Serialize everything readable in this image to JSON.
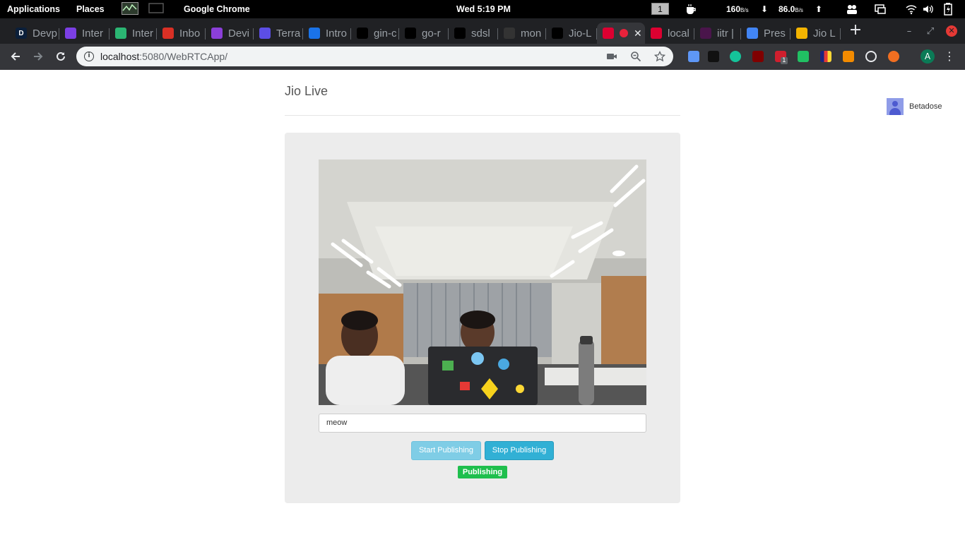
{
  "topbar": {
    "applications": "Applications",
    "places": "Places",
    "app_name": "Google Chrome",
    "clock": "Wed  5:19 PM",
    "workspace": "1",
    "net_down": "160",
    "net_down_unit": "B/s",
    "net_up": "86.0",
    "net_up_unit": "B/s"
  },
  "tabs": [
    {
      "label": "Devp",
      "favicon": "D",
      "color": "#0b1f3a"
    },
    {
      "label": "Inter",
      "favicon": "list-icon",
      "color": "#7b3fe4"
    },
    {
      "label": "Inter",
      "favicon": "puzzle-icon",
      "color": "#2bb673"
    },
    {
      "label": "Inbo",
      "favicon": "gmail-icon",
      "color": "#d93025"
    },
    {
      "label": "Devi",
      "favicon": "house-icon",
      "color": "#8b3fd9"
    },
    {
      "label": "Terra",
      "favicon": "terraform-icon",
      "color": "#5c4ee5"
    },
    {
      "label": "Intro",
      "favicon": "doc-icon",
      "color": "#1a73e8"
    },
    {
      "label": "gin-c",
      "favicon": "github-icon",
      "color": "#000000"
    },
    {
      "label": "go-r",
      "favicon": "github-icon",
      "color": "#000000"
    },
    {
      "label": "sdsl",
      "favicon": "github-icon",
      "color": "#000000"
    },
    {
      "label": "mon",
      "favicon": "godoc-icon",
      "color": "#333333"
    },
    {
      "label": "Jio-L",
      "favicon": "github-icon",
      "color": "#000000"
    },
    {
      "label": "",
      "favicon": "angular-icon",
      "color": "#dd0031",
      "active": true
    },
    {
      "label": "local",
      "favicon": "angular-icon",
      "color": "#dd0031"
    },
    {
      "label": "iitr |",
      "favicon": "slack-icon",
      "color": "#4a154b"
    },
    {
      "label": "Pres",
      "favicon": "docs-icon",
      "color": "#4285f4"
    },
    {
      "label": "Jio L",
      "favicon": "slides-icon",
      "color": "#f4b400"
    }
  ],
  "omnibox": {
    "host": "localhost",
    "path": ":5080/WebRTCApp/"
  },
  "extensions": [
    {
      "name": "pen-icon",
      "color": "#5e97f6"
    },
    {
      "name": "ninja-icon",
      "color": "#111111"
    },
    {
      "name": "grammarly-icon",
      "color": "#15c39a"
    },
    {
      "name": "ublock-icon",
      "color": "#800000"
    },
    {
      "name": "todo-icon",
      "color": "#d01f2e"
    },
    {
      "name": "shield-icon",
      "color": "#21c063"
    },
    {
      "name": "colorful-icon",
      "color": "#ffffff"
    },
    {
      "name": "fox-icon",
      "color": "#f38b00"
    },
    {
      "name": "react-icon",
      "color": "#35363a"
    },
    {
      "name": "lifebuoy-icon",
      "color": "#f26f21"
    }
  ],
  "todo_badge": "1",
  "profile_initial": "A",
  "page": {
    "title": "Jio Live",
    "user_name": "Betadose",
    "stream_name": "meow",
    "start_button": "Start Publishing",
    "stop_button": "Stop Publishing",
    "status": "Publishing"
  },
  "colors": {
    "status_green": "#1fbf4d",
    "primary_button": "#31b0d5",
    "disabled_button": "#7fcde6"
  }
}
